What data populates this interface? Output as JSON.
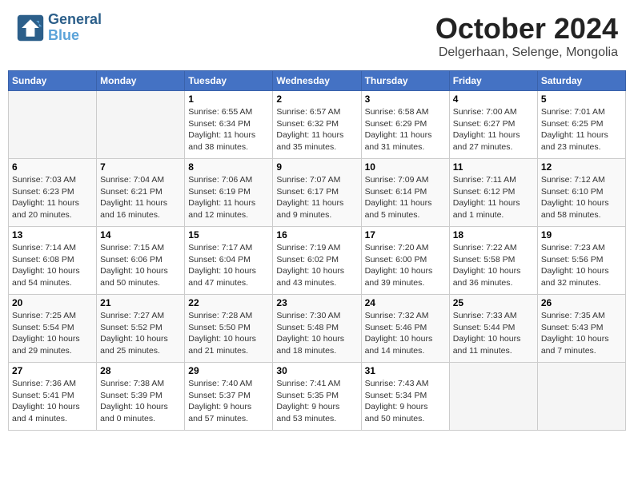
{
  "header": {
    "logo_line1": "General",
    "logo_line2": "Blue",
    "month": "October 2024",
    "location": "Delgerhaan, Selenge, Mongolia"
  },
  "weekdays": [
    "Sunday",
    "Monday",
    "Tuesday",
    "Wednesday",
    "Thursday",
    "Friday",
    "Saturday"
  ],
  "rows": [
    [
      {
        "day": "",
        "info": ""
      },
      {
        "day": "",
        "info": ""
      },
      {
        "day": "1",
        "info": "Sunrise: 6:55 AM\nSunset: 6:34 PM\nDaylight: 11 hours\nand 38 minutes."
      },
      {
        "day": "2",
        "info": "Sunrise: 6:57 AM\nSunset: 6:32 PM\nDaylight: 11 hours\nand 35 minutes."
      },
      {
        "day": "3",
        "info": "Sunrise: 6:58 AM\nSunset: 6:29 PM\nDaylight: 11 hours\nand 31 minutes."
      },
      {
        "day": "4",
        "info": "Sunrise: 7:00 AM\nSunset: 6:27 PM\nDaylight: 11 hours\nand 27 minutes."
      },
      {
        "day": "5",
        "info": "Sunrise: 7:01 AM\nSunset: 6:25 PM\nDaylight: 11 hours\nand 23 minutes."
      }
    ],
    [
      {
        "day": "6",
        "info": "Sunrise: 7:03 AM\nSunset: 6:23 PM\nDaylight: 11 hours\nand 20 minutes."
      },
      {
        "day": "7",
        "info": "Sunrise: 7:04 AM\nSunset: 6:21 PM\nDaylight: 11 hours\nand 16 minutes."
      },
      {
        "day": "8",
        "info": "Sunrise: 7:06 AM\nSunset: 6:19 PM\nDaylight: 11 hours\nand 12 minutes."
      },
      {
        "day": "9",
        "info": "Sunrise: 7:07 AM\nSunset: 6:17 PM\nDaylight: 11 hours\nand 9 minutes."
      },
      {
        "day": "10",
        "info": "Sunrise: 7:09 AM\nSunset: 6:14 PM\nDaylight: 11 hours\nand 5 minutes."
      },
      {
        "day": "11",
        "info": "Sunrise: 7:11 AM\nSunset: 6:12 PM\nDaylight: 11 hours\nand 1 minute."
      },
      {
        "day": "12",
        "info": "Sunrise: 7:12 AM\nSunset: 6:10 PM\nDaylight: 10 hours\nand 58 minutes."
      }
    ],
    [
      {
        "day": "13",
        "info": "Sunrise: 7:14 AM\nSunset: 6:08 PM\nDaylight: 10 hours\nand 54 minutes."
      },
      {
        "day": "14",
        "info": "Sunrise: 7:15 AM\nSunset: 6:06 PM\nDaylight: 10 hours\nand 50 minutes."
      },
      {
        "day": "15",
        "info": "Sunrise: 7:17 AM\nSunset: 6:04 PM\nDaylight: 10 hours\nand 47 minutes."
      },
      {
        "day": "16",
        "info": "Sunrise: 7:19 AM\nSunset: 6:02 PM\nDaylight: 10 hours\nand 43 minutes."
      },
      {
        "day": "17",
        "info": "Sunrise: 7:20 AM\nSunset: 6:00 PM\nDaylight: 10 hours\nand 39 minutes."
      },
      {
        "day": "18",
        "info": "Sunrise: 7:22 AM\nSunset: 5:58 PM\nDaylight: 10 hours\nand 36 minutes."
      },
      {
        "day": "19",
        "info": "Sunrise: 7:23 AM\nSunset: 5:56 PM\nDaylight: 10 hours\nand 32 minutes."
      }
    ],
    [
      {
        "day": "20",
        "info": "Sunrise: 7:25 AM\nSunset: 5:54 PM\nDaylight: 10 hours\nand 29 minutes."
      },
      {
        "day": "21",
        "info": "Sunrise: 7:27 AM\nSunset: 5:52 PM\nDaylight: 10 hours\nand 25 minutes."
      },
      {
        "day": "22",
        "info": "Sunrise: 7:28 AM\nSunset: 5:50 PM\nDaylight: 10 hours\nand 21 minutes."
      },
      {
        "day": "23",
        "info": "Sunrise: 7:30 AM\nSunset: 5:48 PM\nDaylight: 10 hours\nand 18 minutes."
      },
      {
        "day": "24",
        "info": "Sunrise: 7:32 AM\nSunset: 5:46 PM\nDaylight: 10 hours\nand 14 minutes."
      },
      {
        "day": "25",
        "info": "Sunrise: 7:33 AM\nSunset: 5:44 PM\nDaylight: 10 hours\nand 11 minutes."
      },
      {
        "day": "26",
        "info": "Sunrise: 7:35 AM\nSunset: 5:43 PM\nDaylight: 10 hours\nand 7 minutes."
      }
    ],
    [
      {
        "day": "27",
        "info": "Sunrise: 7:36 AM\nSunset: 5:41 PM\nDaylight: 10 hours\nand 4 minutes."
      },
      {
        "day": "28",
        "info": "Sunrise: 7:38 AM\nSunset: 5:39 PM\nDaylight: 10 hours\nand 0 minutes."
      },
      {
        "day": "29",
        "info": "Sunrise: 7:40 AM\nSunset: 5:37 PM\nDaylight: 9 hours\nand 57 minutes."
      },
      {
        "day": "30",
        "info": "Sunrise: 7:41 AM\nSunset: 5:35 PM\nDaylight: 9 hours\nand 53 minutes."
      },
      {
        "day": "31",
        "info": "Sunrise: 7:43 AM\nSunset: 5:34 PM\nDaylight: 9 hours\nand 50 minutes."
      },
      {
        "day": "",
        "info": ""
      },
      {
        "day": "",
        "info": ""
      }
    ]
  ]
}
